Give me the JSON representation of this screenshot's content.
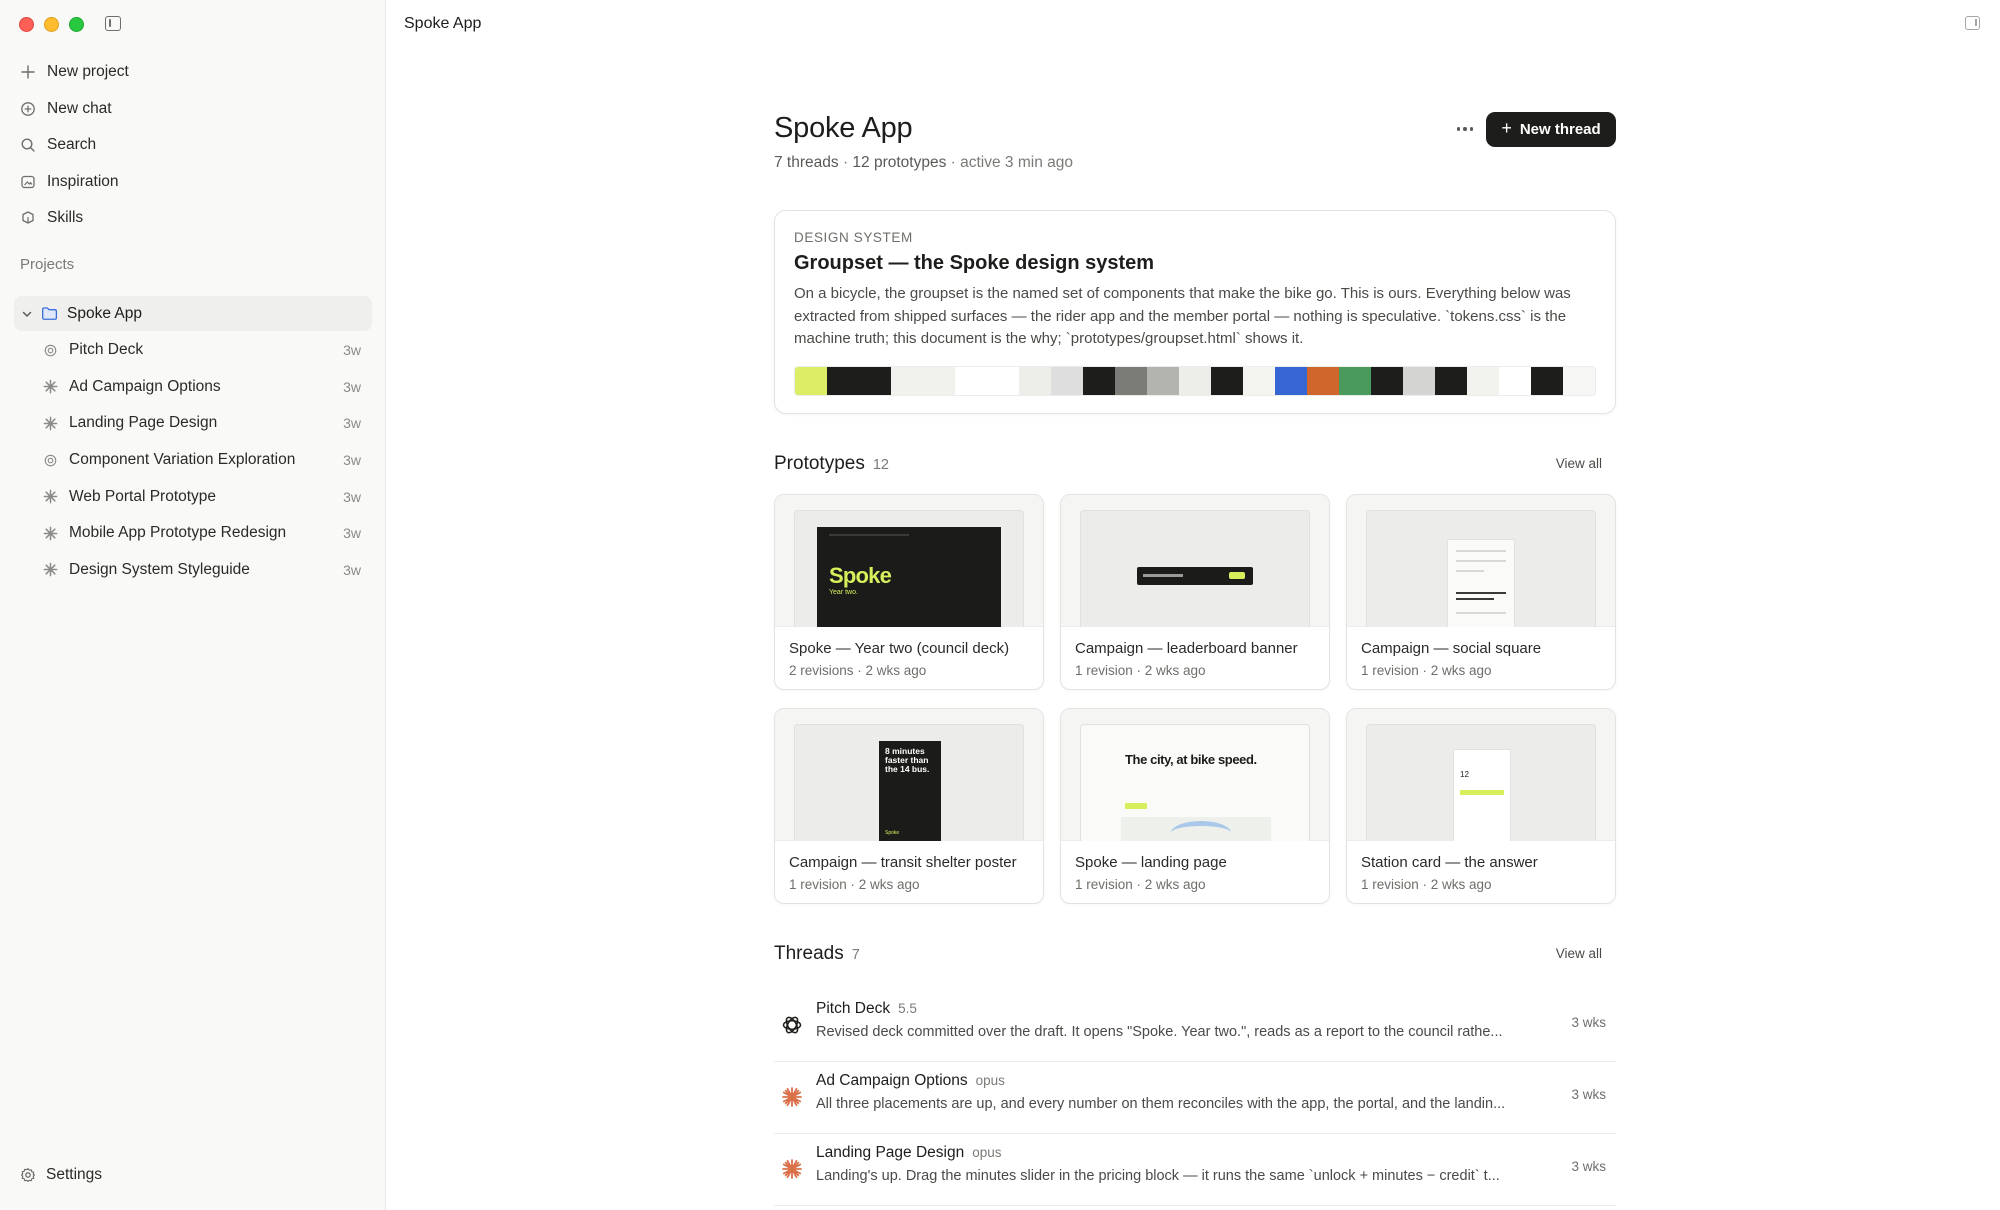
{
  "app": {
    "window_title": "Spoke App"
  },
  "sidebar": {
    "nav": [
      {
        "label": "New project",
        "icon": "plus-icon"
      },
      {
        "label": "New chat",
        "icon": "chat-plus-icon"
      },
      {
        "label": "Search",
        "icon": "search-icon"
      },
      {
        "label": "Inspiration",
        "icon": "inspiration-icon"
      },
      {
        "label": "Skills",
        "icon": "skills-icon"
      }
    ],
    "projects_label": "Projects",
    "project": {
      "name": "Spoke App",
      "expanded": true
    },
    "threads": [
      {
        "label": "Pitch Deck",
        "age": "3w",
        "icon": "openai-icon"
      },
      {
        "label": "Ad Campaign Options",
        "age": "3w",
        "icon": "claude-icon"
      },
      {
        "label": "Landing Page Design",
        "age": "3w",
        "icon": "claude-icon"
      },
      {
        "label": "Component Variation Exploration",
        "age": "3w",
        "icon": "openai-icon"
      },
      {
        "label": "Web Portal Prototype",
        "age": "3w",
        "icon": "claude-icon"
      },
      {
        "label": "Mobile App Prototype Redesign",
        "age": "3w",
        "icon": "claude-icon"
      },
      {
        "label": "Design System Styleguide",
        "age": "3w",
        "icon": "claude-icon"
      }
    ],
    "settings_label": "Settings"
  },
  "header": {
    "title": "Spoke App",
    "meta_threads": "7 threads",
    "meta_sep1": " · ",
    "meta_prototypes": "12 prototypes",
    "meta_active": " · active 3 min ago",
    "new_thread_label": "New thread"
  },
  "design_system": {
    "eyebrow": "DESIGN SYSTEM",
    "title": "Groupset — the Spoke design system",
    "body": "On a bicycle, the groupset is the named set of components that make the bike go. This is ours. Everything below was extracted from shipped surfaces — the rider app and the member portal — nothing is speculative. `tokens.css` is the machine truth; this document is the why; `prototypes/groupset.html` shows it.",
    "swatches": [
      "#dcee66",
      "#1d1d1b",
      "#1d1d1b",
      "#f1f1ee",
      "#f1f1ee",
      "#ffffff",
      "#ffffff",
      "#ededea",
      "#dedede",
      "#1d1d1b",
      "#7b7b78",
      "#b3b3b0",
      "#ededea",
      "#1d1d1b",
      "#f4f4f1",
      "#3566d4",
      "#d1662d",
      "#4a9a5e",
      "#1d1d1b",
      "#d4d4d2",
      "#1d1d1b",
      "#f2f2ef",
      "#ffffff",
      "#1d1d1b",
      "#f7f7f5"
    ]
  },
  "prototypes": {
    "title": "Prototypes",
    "count": "12",
    "view_all": "View all",
    "items": [
      {
        "title": "Spoke — Year two (council deck)",
        "meta": "2 revisions · 2 wks ago",
        "thumb_big": "Spoke",
        "thumb_small": "Year two."
      },
      {
        "title": "Campaign — leaderboard banner",
        "meta": "1 revision · 2 wks ago"
      },
      {
        "title": "Campaign — social square",
        "meta": "1 revision · 2 wks ago"
      },
      {
        "title": "Campaign — transit shelter poster",
        "meta": "1 revision · 2 wks ago",
        "thumb_text": "8 minutes faster than the 14 bus.",
        "thumb_footer": "Spoke"
      },
      {
        "title": "Spoke — landing page",
        "meta": "1 revision · 2 wks ago",
        "thumb_text": "The city, at bike speed."
      },
      {
        "title": "Station card — the answer",
        "meta": "1 revision · 2 wks ago",
        "thumb_number": "12"
      }
    ]
  },
  "threads": {
    "title": "Threads",
    "count": "7",
    "view_all": "View all",
    "items": [
      {
        "name": "Pitch Deck",
        "model": "5.5",
        "icon": "openai-icon",
        "desc": "Revised deck committed over the draft. It opens \"Spoke. Year two.\", reads as a report to the council rathe...",
        "age": "3 wks"
      },
      {
        "name": "Ad Campaign Options",
        "model": "opus",
        "icon": "claude-icon",
        "desc": "All three placements are up, and every number on them reconciles with the app, the portal, and the landin...",
        "age": "3 wks"
      },
      {
        "name": "Landing Page Design",
        "model": "opus",
        "icon": "claude-icon",
        "desc": "Landing's up. Drag the minutes slider in the pricing block — it runs the same `unlock + minutes − credit` t...",
        "age": "3 wks"
      }
    ]
  },
  "colors": {
    "accent_lime": "#d7ef5a",
    "claude_orange": "#d9704a",
    "folder_blue": "#3b6fd8",
    "button_dark": "#1d1d1b"
  }
}
